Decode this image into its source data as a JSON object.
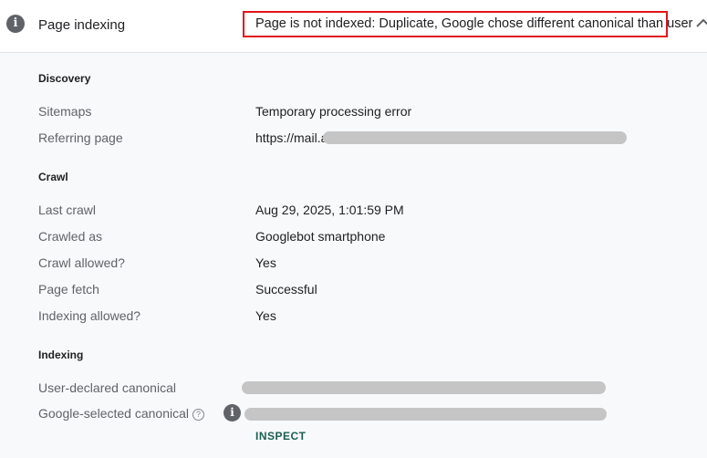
{
  "header": {
    "title": "Page indexing",
    "status": "Page is not indexed: Duplicate, Google chose different canonical than user",
    "info_icon": "i"
  },
  "discovery": {
    "heading": "Discovery",
    "sitemaps_label": "Sitemaps",
    "sitemaps_value": "Temporary processing error",
    "referring_label": "Referring page",
    "referring_value": "https://mail.a"
  },
  "crawl": {
    "heading": "Crawl",
    "last_crawl_label": "Last crawl",
    "last_crawl_value": "Aug 29, 2025, 1:01:59 PM",
    "crawled_as_label": "Crawled as",
    "crawled_as_value": "Googlebot smartphone",
    "crawl_allowed_label": "Crawl allowed?",
    "crawl_allowed_value": "Yes",
    "page_fetch_label": "Page fetch",
    "page_fetch_value": "Successful",
    "indexing_allowed_label": "Indexing allowed?",
    "indexing_allowed_value": "Yes"
  },
  "indexing": {
    "heading": "Indexing",
    "user_canonical_label": "User-declared canonical",
    "google_canonical_label": "Google-selected canonical",
    "help_glyph": "?",
    "info_glyph": "i",
    "inspect_label": "INSPECT"
  },
  "colors": {
    "highlight_border": "#e0151b",
    "redaction": "#c5c5c5",
    "link": "#1a5f54"
  }
}
